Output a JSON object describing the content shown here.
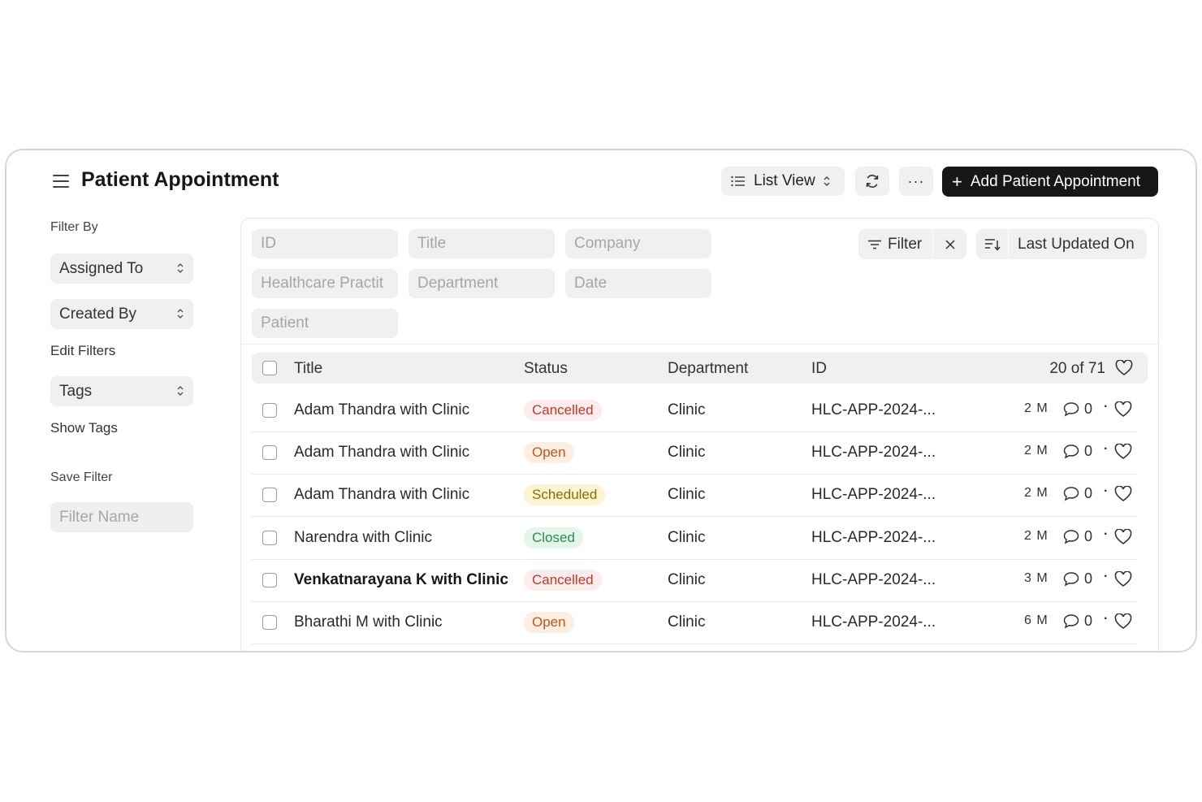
{
  "header": {
    "title": "Patient Appointment",
    "list_view_label": "List View",
    "more_label": "···",
    "add_button_label": "Add Patient Appointment",
    "add_plus": "+"
  },
  "sidebar": {
    "filter_by_label": "Filter By",
    "assigned_to_label": "Assigned To",
    "created_by_label": "Created By",
    "edit_filters_label": "Edit Filters",
    "tags_label": "Tags",
    "show_tags_label": "Show Tags",
    "save_filter_label": "Save Filter",
    "filter_name_placeholder": "Filter Name"
  },
  "filters": {
    "id_placeholder": "ID",
    "title_placeholder": "Title",
    "company_placeholder": "Company",
    "practitioner_placeholder": "Healthcare Practit",
    "department_placeholder": "Department",
    "date_placeholder": "Date",
    "patient_placeholder": "Patient",
    "filter_label": "Filter",
    "sort_label": "Last Updated On"
  },
  "table": {
    "columns": [
      "Title",
      "Status",
      "Department",
      "ID"
    ],
    "count_label": "20 of 71",
    "rows": [
      {
        "title": "Adam Thandra with Clinic",
        "status": "Cancelled",
        "department": "Clinic",
        "id": "HLC-APP-2024-...",
        "modified": "2 M",
        "comments": "0"
      },
      {
        "title": "Adam Thandra with Clinic",
        "status": "Open",
        "department": "Clinic",
        "id": "HLC-APP-2024-...",
        "modified": "2 M",
        "comments": "0"
      },
      {
        "title": "Adam Thandra with Clinic",
        "status": "Scheduled",
        "department": "Clinic",
        "id": "HLC-APP-2024-...",
        "modified": "2 M",
        "comments": "0"
      },
      {
        "title": "Narendra with Clinic",
        "status": "Closed",
        "department": "Clinic",
        "id": "HLC-APP-2024-...",
        "modified": "2 M",
        "comments": "0"
      },
      {
        "title": "Venkatnarayana K with Clinic",
        "status": "Cancelled",
        "department": "Clinic",
        "id": "HLC-APP-2024-...",
        "modified": "3 M",
        "comments": "0"
      },
      {
        "title": "Bharathi M with Clinic",
        "status": "Open",
        "department": "Clinic",
        "id": "HLC-APP-2024-...",
        "modified": "6 M",
        "comments": "0"
      }
    ],
    "dot": "·"
  },
  "status_colors": {
    "Cancelled": {
      "bg": "#fdecec",
      "fg": "#c0392b"
    },
    "Open": {
      "bg": "#fdeee2",
      "fg": "#c5531c"
    },
    "Scheduled": {
      "bg": "#fcf3cf",
      "fg": "#8a6d0b"
    },
    "Closed": {
      "bg": "#e4f5e9",
      "fg": "#2e8b57"
    }
  },
  "icons": [
    "menu-icon",
    "list-icon",
    "refresh-icon",
    "more-icon",
    "plus-icon",
    "filter-icon",
    "close-icon",
    "sort-icon",
    "comment-icon",
    "heart-icon",
    "updown-icon"
  ]
}
